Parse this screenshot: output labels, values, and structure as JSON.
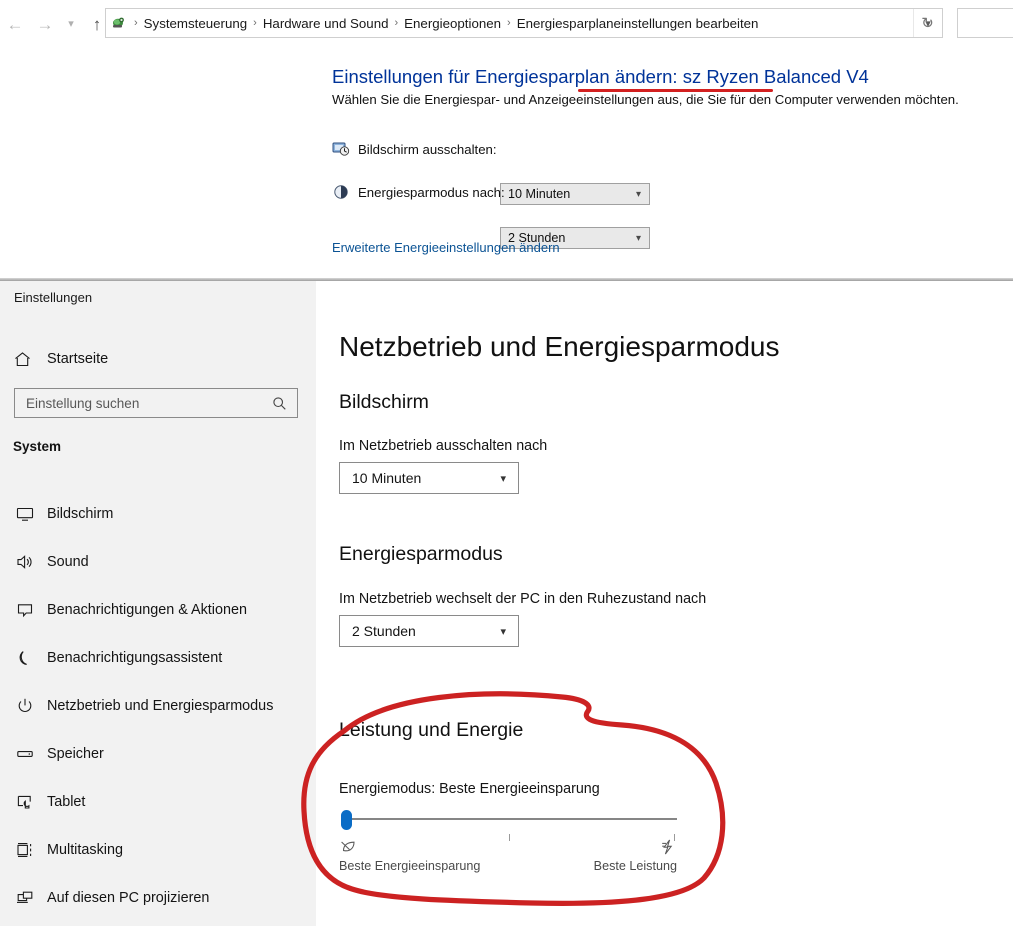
{
  "explorer": {
    "nav": {
      "back_icon": "arrow-left-icon",
      "forward_icon": "arrow-right-icon",
      "history_icon": "chevron-down-icon",
      "up_icon": "arrow-up-icon"
    },
    "address": {
      "icon": "control-panel-icon",
      "breadcrumbs": [
        "Systemsteuerung",
        "Hardware und Sound",
        "Energieoptionen",
        "Energiesparplaneinstellungen bearbeiten"
      ],
      "separator": "›",
      "dropdown_icon": "chevron-down-icon",
      "refresh_icon": "refresh-icon"
    },
    "search_placeholder": ""
  },
  "control_panel": {
    "title_prefix": "Einstellungen für Energiesparplan ändern: ",
    "plan_name": "sz Ryzen Balanced V4",
    "subtitle": "Wählen Sie die Energiespar- und Anzeigeeinstellungen aus, die Sie für den Computer verwenden möchten.",
    "rows": [
      {
        "icon": "display-off-icon",
        "label": "Bildschirm ausschalten:",
        "value": "10 Minuten",
        "chevron": "chevron-down-icon"
      },
      {
        "icon": "sleep-icon",
        "label": "Energiesparmodus nach:",
        "value": "2 Stunden",
        "chevron": "chevron-down-icon"
      }
    ],
    "advanced_link": "Erweiterte Energieeinstellungen ändern"
  },
  "settings": {
    "app_title": "Einstellungen",
    "home": {
      "icon": "home-icon",
      "label": "Startseite"
    },
    "search": {
      "placeholder": "Einstellung suchen",
      "icon": "search-icon"
    },
    "section_header": "System",
    "nav_items": [
      {
        "icon": "monitor-icon",
        "label": "Bildschirm"
      },
      {
        "icon": "speaker-icon",
        "label": "Sound"
      },
      {
        "icon": "chat-bubble-icon",
        "label": "Benachrichtigungen & Aktionen"
      },
      {
        "icon": "moon-icon",
        "label": "Benachrichtigungsassistent"
      },
      {
        "icon": "power-icon",
        "label": "Netzbetrieb und Energiesparmodus"
      },
      {
        "icon": "storage-icon",
        "label": "Speicher"
      },
      {
        "icon": "tablet-icon",
        "label": "Tablet"
      },
      {
        "icon": "multitasking-icon",
        "label": "Multitasking"
      },
      {
        "icon": "project-icon",
        "label": "Auf diesen PC projizieren"
      }
    ],
    "main": {
      "page_title": "Netzbetrieb und Energiesparmodus",
      "display_group": {
        "heading": "Bildschirm",
        "field_label": "Im Netzbetrieb ausschalten nach",
        "value": "10 Minuten",
        "chevron": "chevron-down-icon"
      },
      "sleep_group": {
        "heading": "Energiesparmodus",
        "field_label": "Im Netzbetrieb wechselt der PC in den Ruhezustand nach",
        "value": "2 Stunden",
        "chevron": "chevron-down-icon"
      },
      "performance_group": {
        "heading": "Leistung und Energie",
        "mode_label": "Energiemodus: Beste Energieeinsparung",
        "slider": {
          "position_percent": 0,
          "left_icon": "leaf-icon",
          "right_icon": "lightning-icon",
          "left_label": "Beste Energieeinsparung",
          "right_label": "Beste Leistung"
        }
      }
    }
  },
  "annotations": {
    "color": "#cc2222",
    "underline_target": "sz Ryzen Balanced V4",
    "circle_target": "Leistung und Energie"
  },
  "colors": {
    "cp_title_blue": "#003399",
    "link_blue": "#0b5394",
    "slider_blue": "#0a6cc6",
    "sidebar_bg": "#f2f2f2",
    "annotation_red": "#cc2222"
  }
}
